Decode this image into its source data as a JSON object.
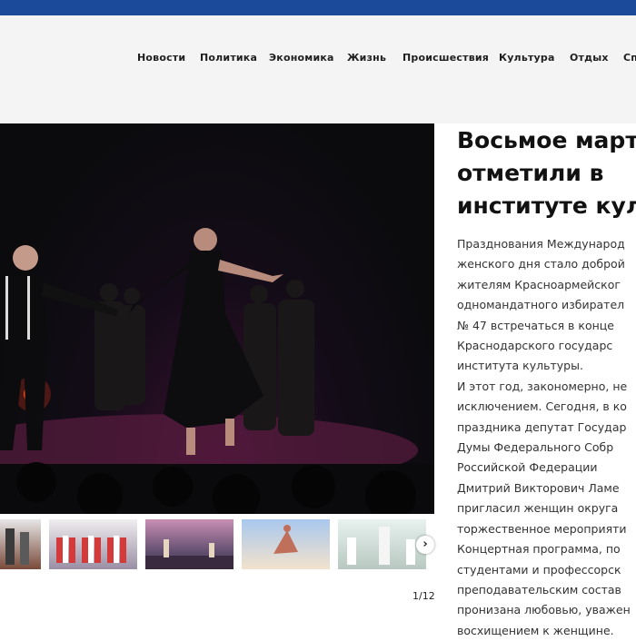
{
  "nav": {
    "items": [
      {
        "label": "Новости"
      },
      {
        "label": "Политика"
      },
      {
        "label": "Экономика"
      },
      {
        "label": "Жизнь"
      },
      {
        "label": "Происшествия"
      },
      {
        "label": "Культура"
      },
      {
        "label": "Отдых"
      },
      {
        "label": "Сп"
      }
    ]
  },
  "article": {
    "title_lines": [
      "Восьмое март",
      "отметили в",
      "институте кул"
    ],
    "body_lines": [
      "Празднования Международ",
      "женского дня  стало доброй",
      "жителям Красноармейског",
      "одномандатного избирател",
      "№ 47  встречаться в конце",
      "Краснодарского  государс",
      "института культуры.",
      "И этот год, закономерно, не",
      "исключением. Сегодня, в ко",
      "праздника депутат Государ",
      "Думы Федерального Собр",
      "Российской Федерации",
      "Дмитрий  Викторович Ламе",
      "пригласил женщин округа",
      "торжественное мероприяти",
      "Концертная программа, по",
      "студентами и профессорск",
      "преподавательским состав",
      "пронизана любовью, уважен",
      "восхищением к женщине."
    ]
  },
  "gallery": {
    "counter": "1/12",
    "next_icon": "chevron-right-icon",
    "next_glyph": "›"
  },
  "colors": {
    "topbar": "#1b4a9a",
    "header_bg": "#f4f4f4"
  }
}
